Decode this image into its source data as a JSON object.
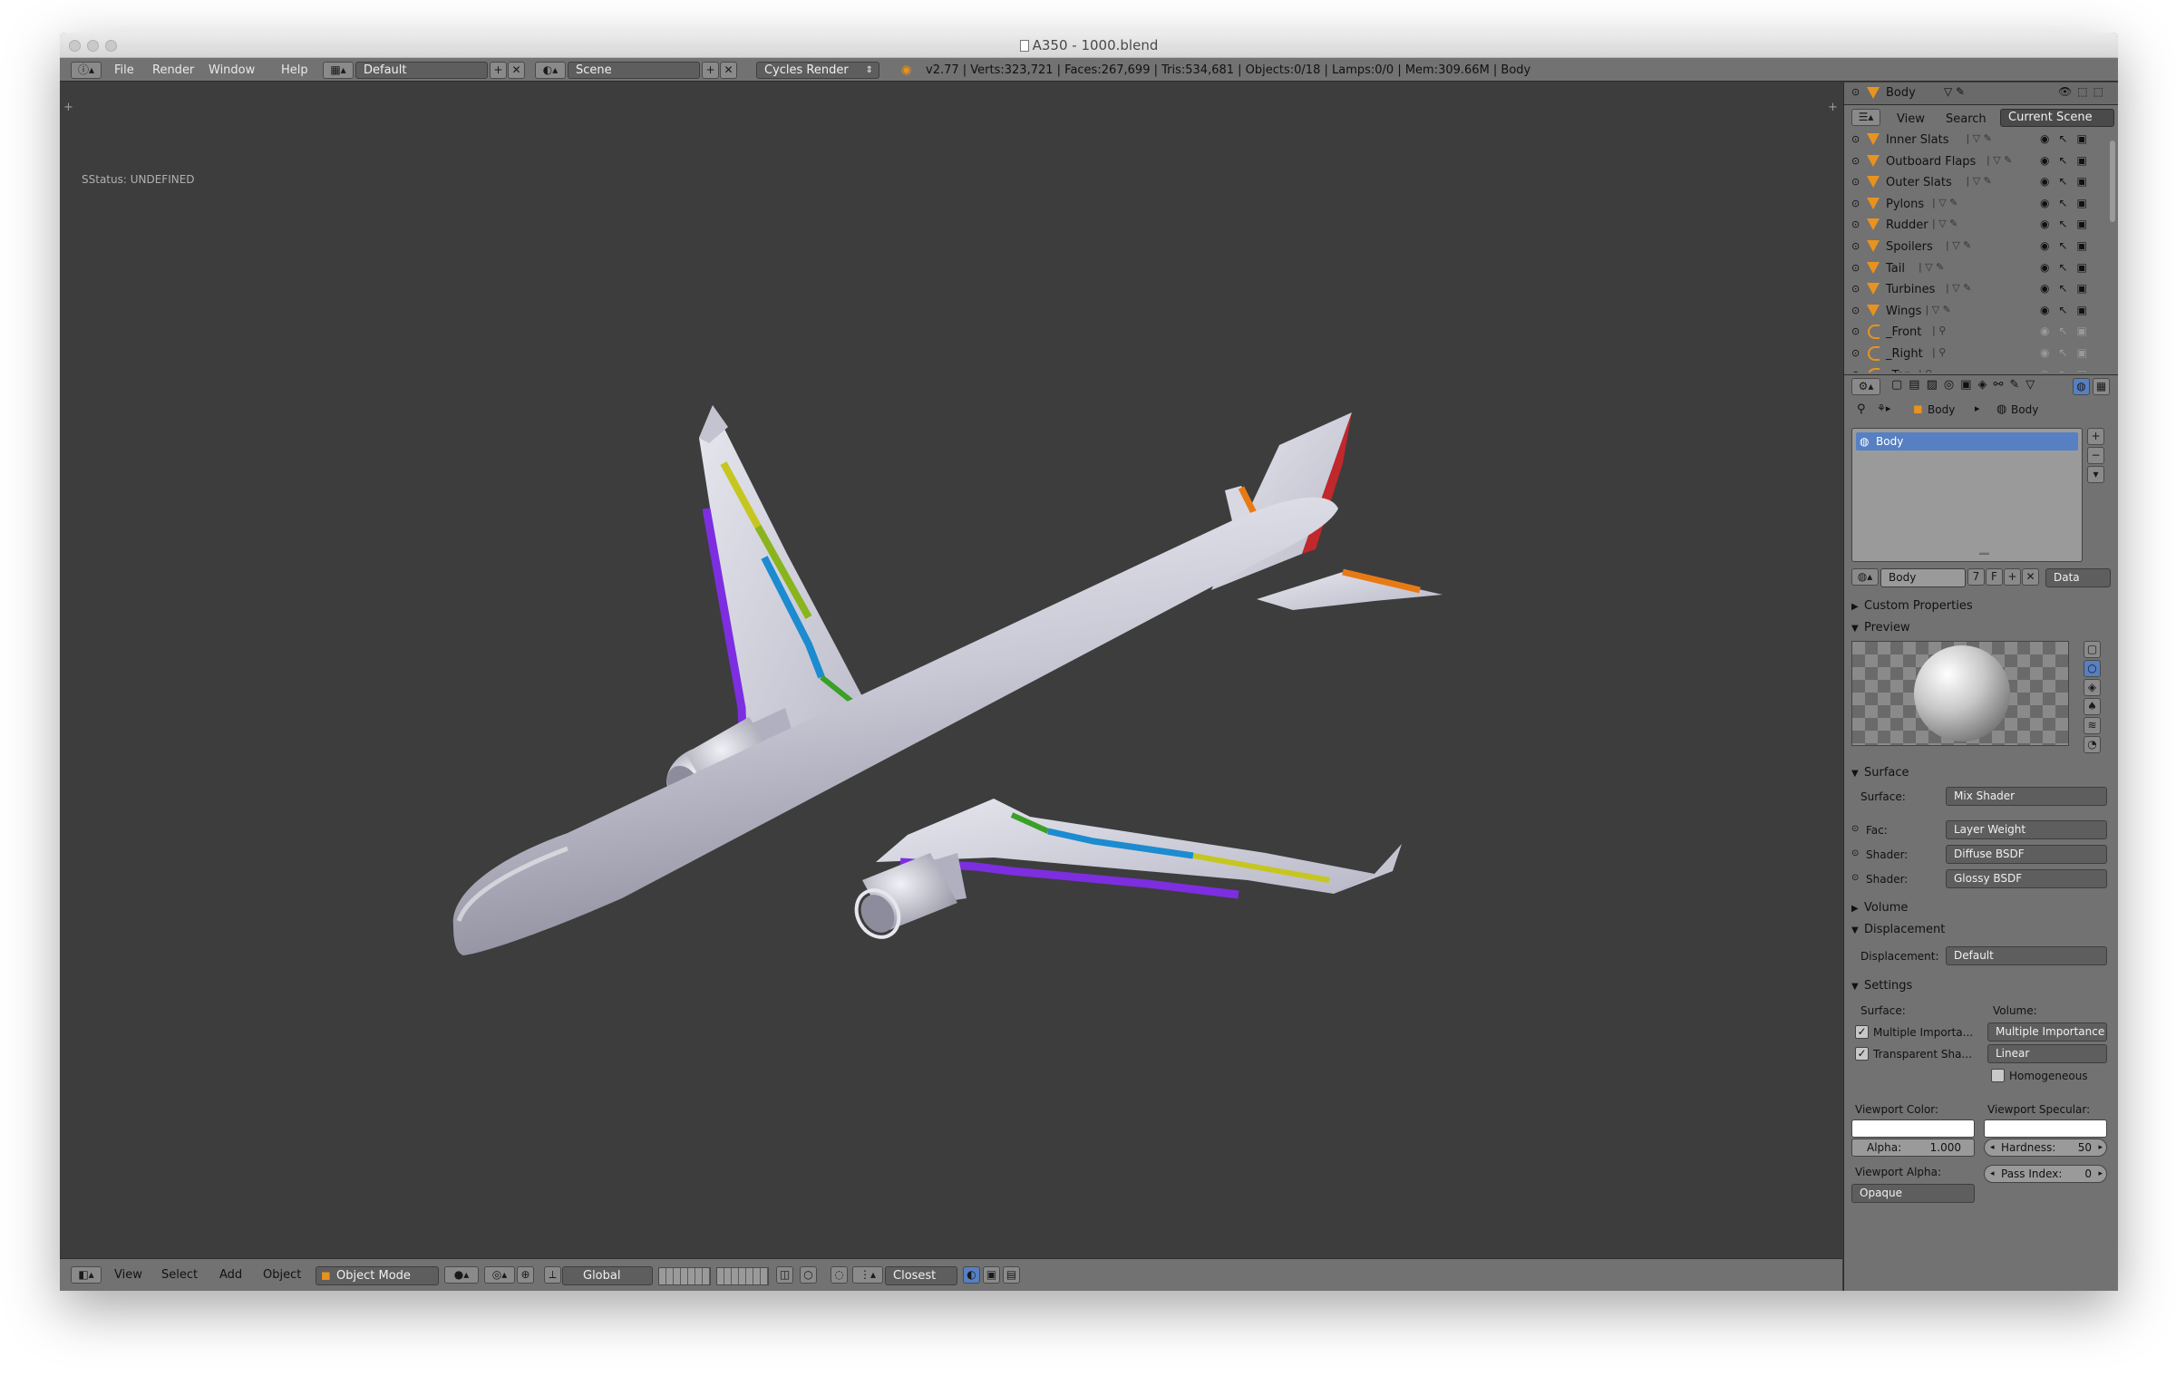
{
  "window": {
    "title": "A350 - 1000.blend"
  },
  "infobar": {
    "menus": [
      "File",
      "Render",
      "Window",
      "Help"
    ],
    "layout": "Default",
    "scene": "Scene",
    "engine": "Cycles Render",
    "stats": "v2.77 | Verts:323,721 | Faces:267,699 | Tris:534,681 | Objects:0/18 | Lamps:0/0 | Mem:309.66M | Body"
  },
  "viewport": {
    "status": "SStatus: UNDEFINED"
  },
  "vtoolbar": {
    "menus": [
      "View",
      "Select",
      "Add",
      "Object"
    ],
    "mode": "Object Mode",
    "orientation": "Global",
    "snap": "Closest"
  },
  "outliner": {
    "header_object": "Body",
    "tabs": [
      "View",
      "Search",
      "Current Scene"
    ],
    "items": [
      {
        "name": "Inner Slats",
        "kind": "mesh"
      },
      {
        "name": "Outboard Flaps",
        "kind": "mesh"
      },
      {
        "name": "Outer Slats",
        "kind": "mesh"
      },
      {
        "name": "Pylons",
        "kind": "mesh"
      },
      {
        "name": "Rudder",
        "kind": "mesh"
      },
      {
        "name": "Spoilers",
        "kind": "mesh"
      },
      {
        "name": "Tail",
        "kind": "mesh"
      },
      {
        "name": "Turbines",
        "kind": "mesh"
      },
      {
        "name": "Wings",
        "kind": "mesh"
      },
      {
        "name": "_Front",
        "kind": "camera"
      },
      {
        "name": "_Right",
        "kind": "camera"
      },
      {
        "name": "_Top",
        "kind": "camera"
      }
    ]
  },
  "properties": {
    "breadcrumb": [
      "Body",
      "Body"
    ],
    "material_slot": "Body",
    "material_name": "Body",
    "users": "7",
    "fake": "F",
    "link": "Data",
    "sections": {
      "custom": "Custom Properties",
      "preview": "Preview",
      "surface": "Surface",
      "volume": "Volume",
      "displacement": "Displacement",
      "settings": "Settings"
    },
    "surface_label": "Surface:",
    "surface_value": "Mix Shader",
    "fac_label": "Fac:",
    "fac_value": "Layer Weight",
    "shader1_label": "Shader:",
    "shader1_value": "Diffuse BSDF",
    "shader2_label": "Shader:",
    "shader2_value": "Glossy BSDF",
    "displacement_label": "Displacement:",
    "displacement_value": "Default",
    "settings_surface": "Surface:",
    "settings_volume": "Volume:",
    "mis_label": "Multiple Importa...",
    "transparent_label": "Transparent Sha...",
    "volume_sampling": "Multiple Importance",
    "volume_interp": "Linear",
    "homogeneous": "Homogeneous",
    "viewport_color": "Viewport Color:",
    "viewport_specular": "Viewport Specular:",
    "alpha_label": "Alpha:",
    "alpha_value": "1.000",
    "hardness_label": "Hardness:",
    "hardness_value": "50",
    "viewport_alpha": "Viewport Alpha:",
    "pass_index_label": "Pass Index:",
    "pass_index_value": "0",
    "alpha_mode": "Opaque"
  }
}
